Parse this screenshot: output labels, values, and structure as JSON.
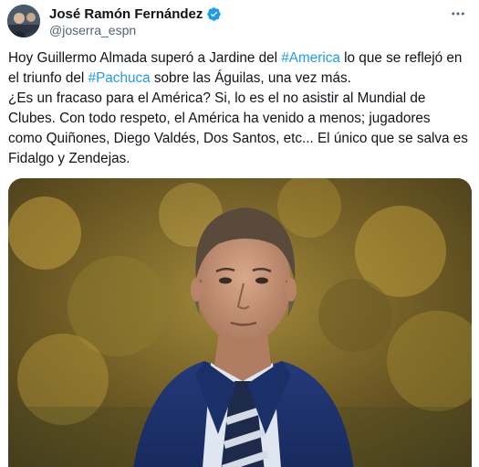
{
  "author": {
    "display_name": "José Ramón Fernández",
    "handle": "@joserra_espn",
    "verified": true,
    "verified_color": "#1d9bf0"
  },
  "menu": {
    "icon": "more-horizontal-icon"
  },
  "tweet": {
    "lines": [
      [
        {
          "text": "Hoy Guillermo Almada superó a Jardine del ",
          "type": "text"
        },
        {
          "text": "#America",
          "type": "hashtag"
        },
        {
          "text": " lo que se reflejó en",
          "type": "text"
        }
      ],
      [
        {
          "text": "el triunfo del ",
          "type": "text"
        },
        {
          "text": "#Pachuca",
          "type": "hashtag"
        },
        {
          "text": " sobre las Águilas, una vez más.",
          "type": "text"
        }
      ],
      [
        {
          "text": "¿Es un fracaso para el América? Si, lo es el no asistir al Mundial de",
          "type": "text"
        }
      ],
      [
        {
          "text": "Clubes. Con todo respeto, el América ha venido a menos; jugadores",
          "type": "text"
        }
      ],
      [
        {
          "text": "como Quiñones, Diego Valdés, Dos Santos, etc... El único que se salva es",
          "type": "text"
        }
      ],
      [
        {
          "text": "Fidalgo y Zendejas.",
          "type": "text"
        }
      ]
    ],
    "hashtag_color": "#1d9bf0"
  },
  "media": {
    "kind": "photo",
    "subject": "coach-photo"
  }
}
